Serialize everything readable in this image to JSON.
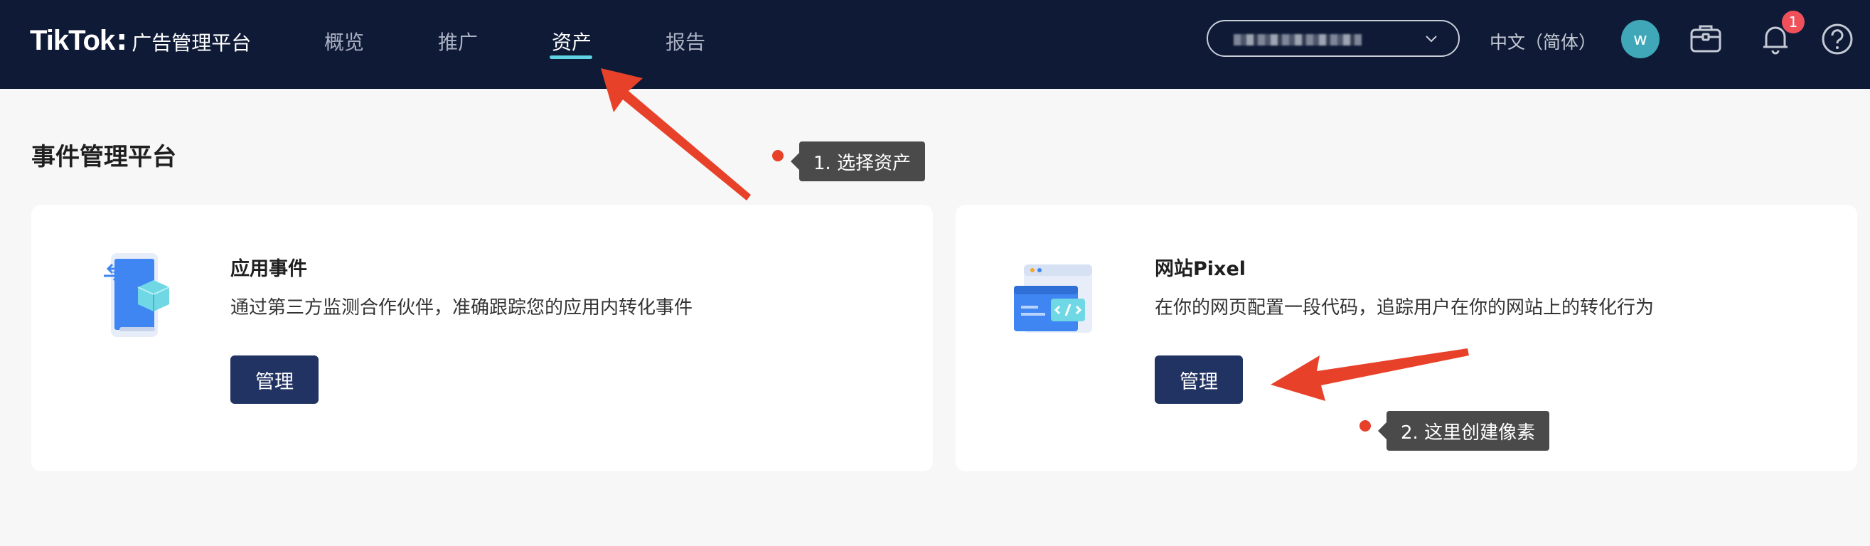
{
  "header": {
    "brand": "TikTok",
    "brand_sub": "广告管理平台",
    "nav": [
      {
        "label": "概览"
      },
      {
        "label": "推广"
      },
      {
        "label": "资产"
      },
      {
        "label": "报告"
      }
    ],
    "active_nav": "资产",
    "language": "中文（简体）",
    "avatar_initial": "w",
    "notification_count": "1",
    "accent_color": "#5fd3e3"
  },
  "page": {
    "title": "事件管理平台"
  },
  "cards": [
    {
      "title": "应用事件",
      "description": "通过第三方监测合作伙伴，准确跟踪您的应用内转化事件",
      "button_label": "管理",
      "icon": "mobile-app-cube-icon"
    },
    {
      "title": "网站Pixel",
      "description": "在你的网页配置一段代码，追踪用户在你的网站上的转化行为",
      "button_label": "管理",
      "icon": "browser-code-icon"
    }
  ],
  "annotations": [
    {
      "label": "1. 选择资产"
    },
    {
      "label": "2. 这里创建像素"
    }
  ]
}
